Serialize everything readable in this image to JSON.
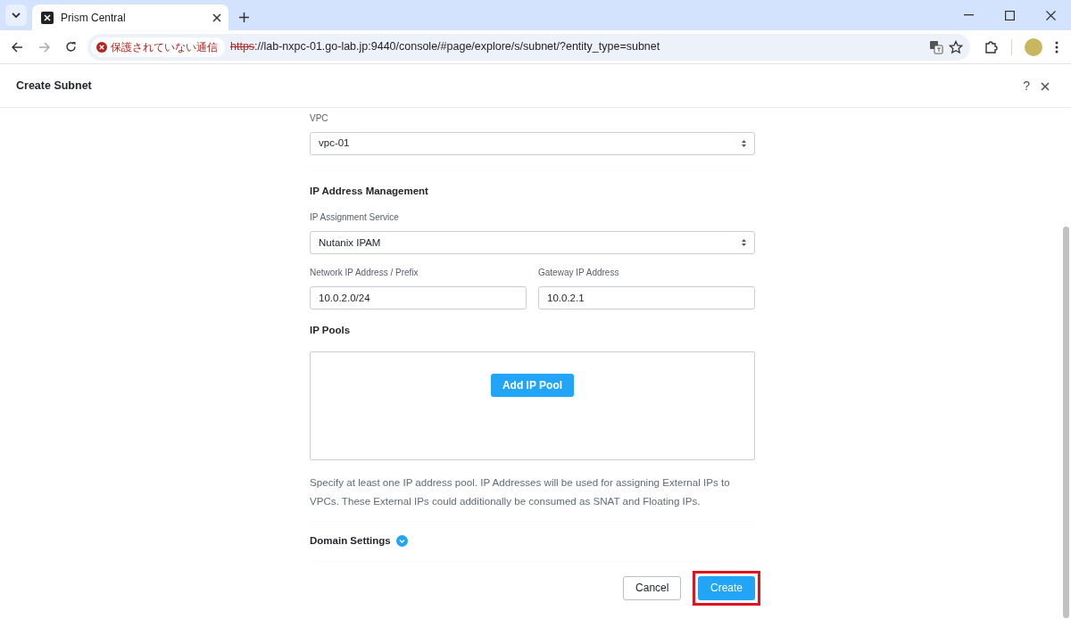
{
  "browser": {
    "tab_title": "Prism Central",
    "security_label": "保護されていない通信",
    "secure": false,
    "url_scheme": "https",
    "url_rest": "://lab-nxpc-01.go-lab.jp:9440/console/#page/explore/s/subnet/?entity_type=subnet"
  },
  "dialog": {
    "title": "Create Subnet",
    "help": "?"
  },
  "vpc": {
    "label": "VPC",
    "value": "vpc-01"
  },
  "ipam": {
    "heading": "IP Address Management",
    "service_label": "IP Assignment Service",
    "service_value": "Nutanix IPAM",
    "network_label": "Network IP Address / Prefix",
    "network_value": "10.0.2.0/24",
    "gateway_label": "Gateway IP Address",
    "gateway_value": "10.0.2.1"
  },
  "ip_pools": {
    "heading": "IP Pools",
    "add_button": "Add IP Pool",
    "help_text": "Specify at least one IP address pool. IP Addresses will be used for assigning External IPs to VPCs. These External IPs could additionally be consumed as SNAT and Floating IPs."
  },
  "domain_settings": {
    "label": "Domain Settings",
    "expanded": false
  },
  "footer": {
    "buttons": [
      {
        "label": "Cancel",
        "kind": "secondary",
        "highlighted": false
      },
      {
        "label": "Create",
        "kind": "primary",
        "highlighted": true
      }
    ]
  }
}
